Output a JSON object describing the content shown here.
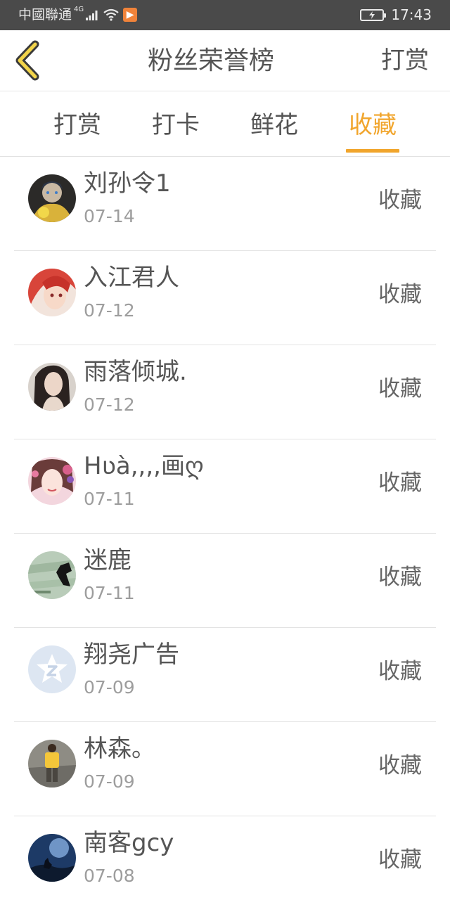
{
  "status_bar": {
    "carrier": "中國聯通",
    "network": "4G",
    "app_badge": "▶",
    "time": "17:43"
  },
  "header": {
    "title": "粉丝荣誉榜",
    "action_label": "打赏"
  },
  "tabs": [
    {
      "label": "打赏",
      "active": false
    },
    {
      "label": "打卡",
      "active": false
    },
    {
      "label": "鲜花",
      "active": false
    },
    {
      "label": "收藏",
      "active": true
    }
  ],
  "colors": {
    "accent": "#f1a52c",
    "status_bar": "#4a4a4a"
  },
  "rows": [
    {
      "name": "刘孙令1",
      "date": "07-14",
      "action": "收藏",
      "avatar": "anime-boy-avatar"
    },
    {
      "name": "入江君人",
      "date": "07-12",
      "action": "收藏",
      "avatar": "red-hair-anime-avatar"
    },
    {
      "name": "雨落倾城.",
      "date": "07-12",
      "action": "收藏",
      "avatar": "woman-photo-avatar"
    },
    {
      "name": "Hʋà,,,,画ღ",
      "date": "07-11",
      "action": "收藏",
      "avatar": "girl-flowers-avatar"
    },
    {
      "name": "迷鹿",
      "date": "07-11",
      "action": "收藏",
      "avatar": "green-scene-avatar"
    },
    {
      "name": "翔尧广告",
      "date": "07-09",
      "action": "收藏",
      "avatar": "default-star-avatar"
    },
    {
      "name": "林森。",
      "date": "07-09",
      "action": "收藏",
      "avatar": "yellow-shirt-avatar"
    },
    {
      "name": "南客gcy",
      "date": "07-08",
      "action": "收藏",
      "avatar": "night-wolf-avatar"
    }
  ]
}
